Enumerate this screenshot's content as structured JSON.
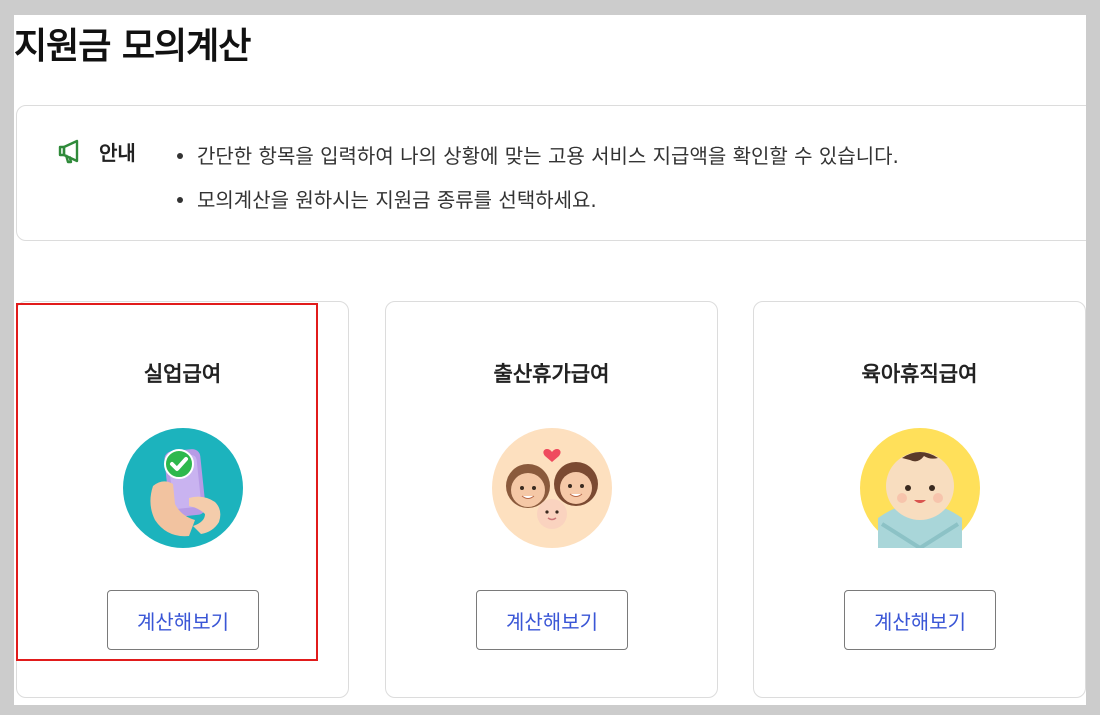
{
  "page": {
    "title": "지원금 모의계산"
  },
  "notice": {
    "icon": "megaphone-icon",
    "label": "안내",
    "items": [
      "간단한 항목을 입력하여 나의 상황에 맞는 고용 서비스 지급액을 확인할 수 있습니다.",
      "모의계산을 원하시는 지원금 종류를 선택하세요."
    ]
  },
  "cards": [
    {
      "title": "실업급여",
      "icon": "phone-check-hand-icon",
      "button_label": "계산해보기",
      "highlighted": true
    },
    {
      "title": "출산휴가급여",
      "icon": "family-baby-heart-icon",
      "button_label": "계산해보기",
      "highlighted": false
    },
    {
      "title": "육아휴직급여",
      "icon": "swaddled-baby-icon",
      "button_label": "계산해보기",
      "highlighted": false
    }
  ],
  "colors": {
    "accent_green": "#2f8a3a",
    "button_text": "#3a56d6",
    "highlight_border": "#e11b1b"
  }
}
